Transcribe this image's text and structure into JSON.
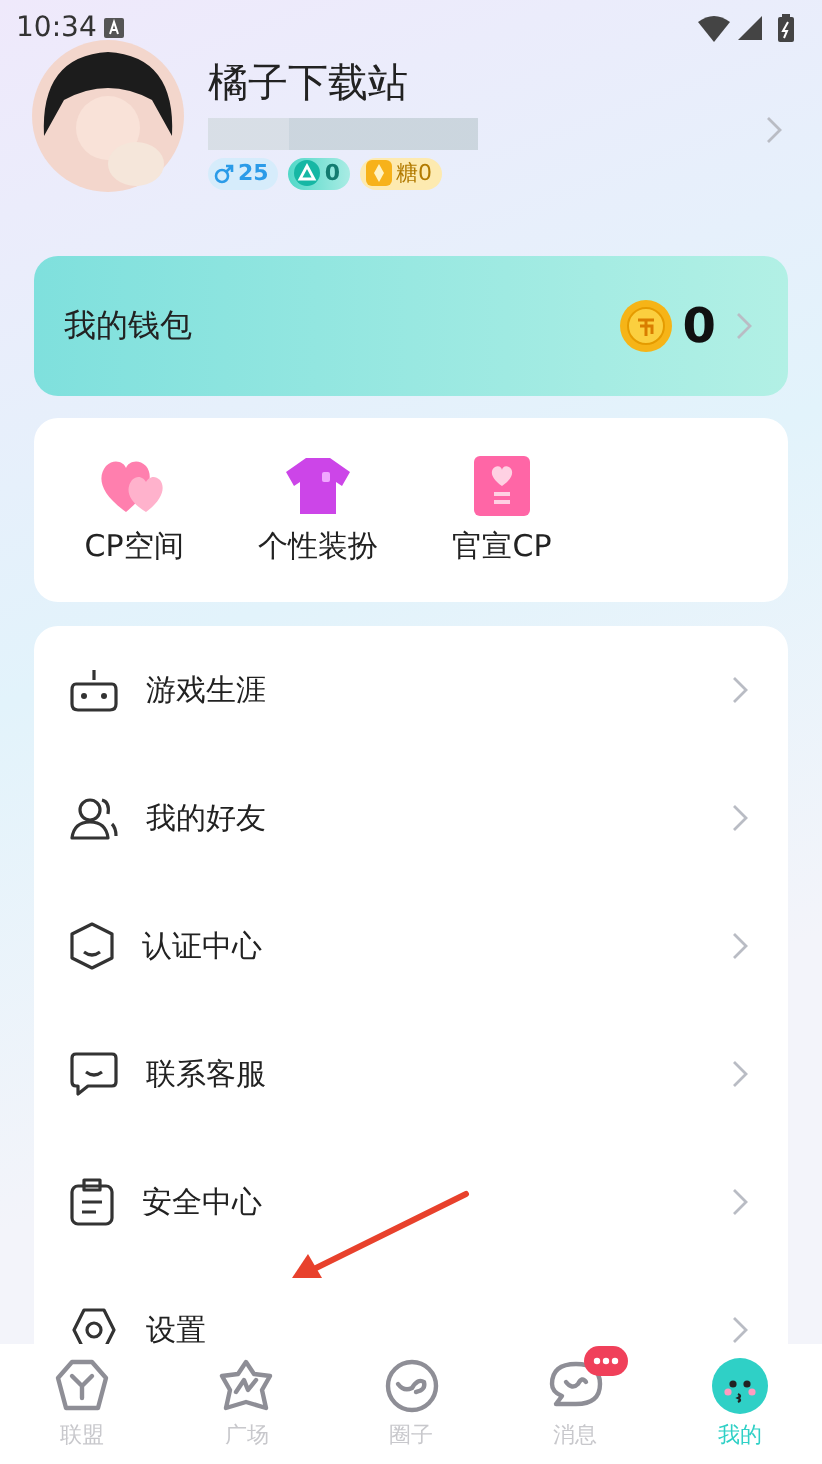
{
  "status_bar": {
    "time": "10:34"
  },
  "profile": {
    "name": "橘子下载站",
    "badges": [
      {
        "kind": "gender",
        "text": "25"
      },
      {
        "kind": "level",
        "text": "0"
      },
      {
        "kind": "candy",
        "text": "糖0"
      }
    ]
  },
  "wallet": {
    "label": "我的钱包",
    "balance": "0"
  },
  "shortcuts": [
    {
      "kind": "hearts",
      "label": "CP空间"
    },
    {
      "kind": "shirt",
      "label": "个性装扮"
    },
    {
      "kind": "card",
      "label": "官宣CP"
    }
  ],
  "menu": [
    {
      "kind": "gamepad",
      "label": "游戏生涯"
    },
    {
      "kind": "friends",
      "label": "我的好友"
    },
    {
      "kind": "shield",
      "label": "认证中心"
    },
    {
      "kind": "chat",
      "label": "联系客服"
    },
    {
      "kind": "lock",
      "label": "安全中心"
    },
    {
      "kind": "gear",
      "label": "设置"
    }
  ],
  "tabs": [
    {
      "kind": "alliance",
      "label": "联盟",
      "selected": false,
      "badge": false
    },
    {
      "kind": "square",
      "label": "广场",
      "selected": false,
      "badge": false
    },
    {
      "kind": "circle",
      "label": "圈子",
      "selected": false,
      "badge": false
    },
    {
      "kind": "messages",
      "label": "消息",
      "selected": false,
      "badge": true
    },
    {
      "kind": "me",
      "label": "我的",
      "selected": true,
      "badge": false
    }
  ]
}
